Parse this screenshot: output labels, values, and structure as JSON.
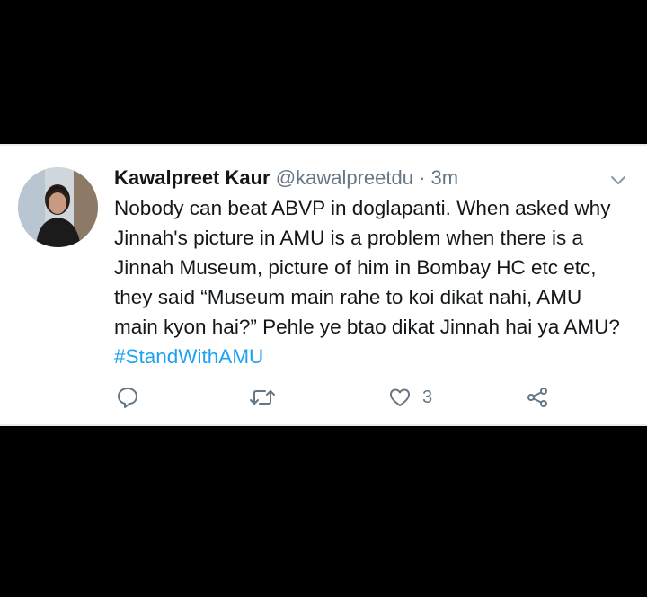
{
  "tweet": {
    "author_name": "Kawalpreet Kaur",
    "handle": "@kawalpreetdu",
    "separator": "·",
    "time": "3m",
    "text": "Nobody can beat ABVP in doglapanti. When asked why Jinnah's picture in AMU is a problem when there is a Jinnah Museum, picture of him in Bombay HC etc etc, they said “Museum main rahe to koi dikat nahi, AMU main kyon hai?” Pehle ye btao dikat Jinnah hai ya AMU?",
    "hashtag": "#StandWithAMU"
  },
  "actions": {
    "reply_icon": "reply-icon",
    "retweet_icon": "retweet-icon",
    "like_icon": "heart-icon",
    "like_count": "3",
    "share_icon": "share-icon"
  },
  "colors": {
    "text": "#14171a",
    "secondary": "#657786",
    "accent": "#1da1f2",
    "background": "#000000"
  }
}
